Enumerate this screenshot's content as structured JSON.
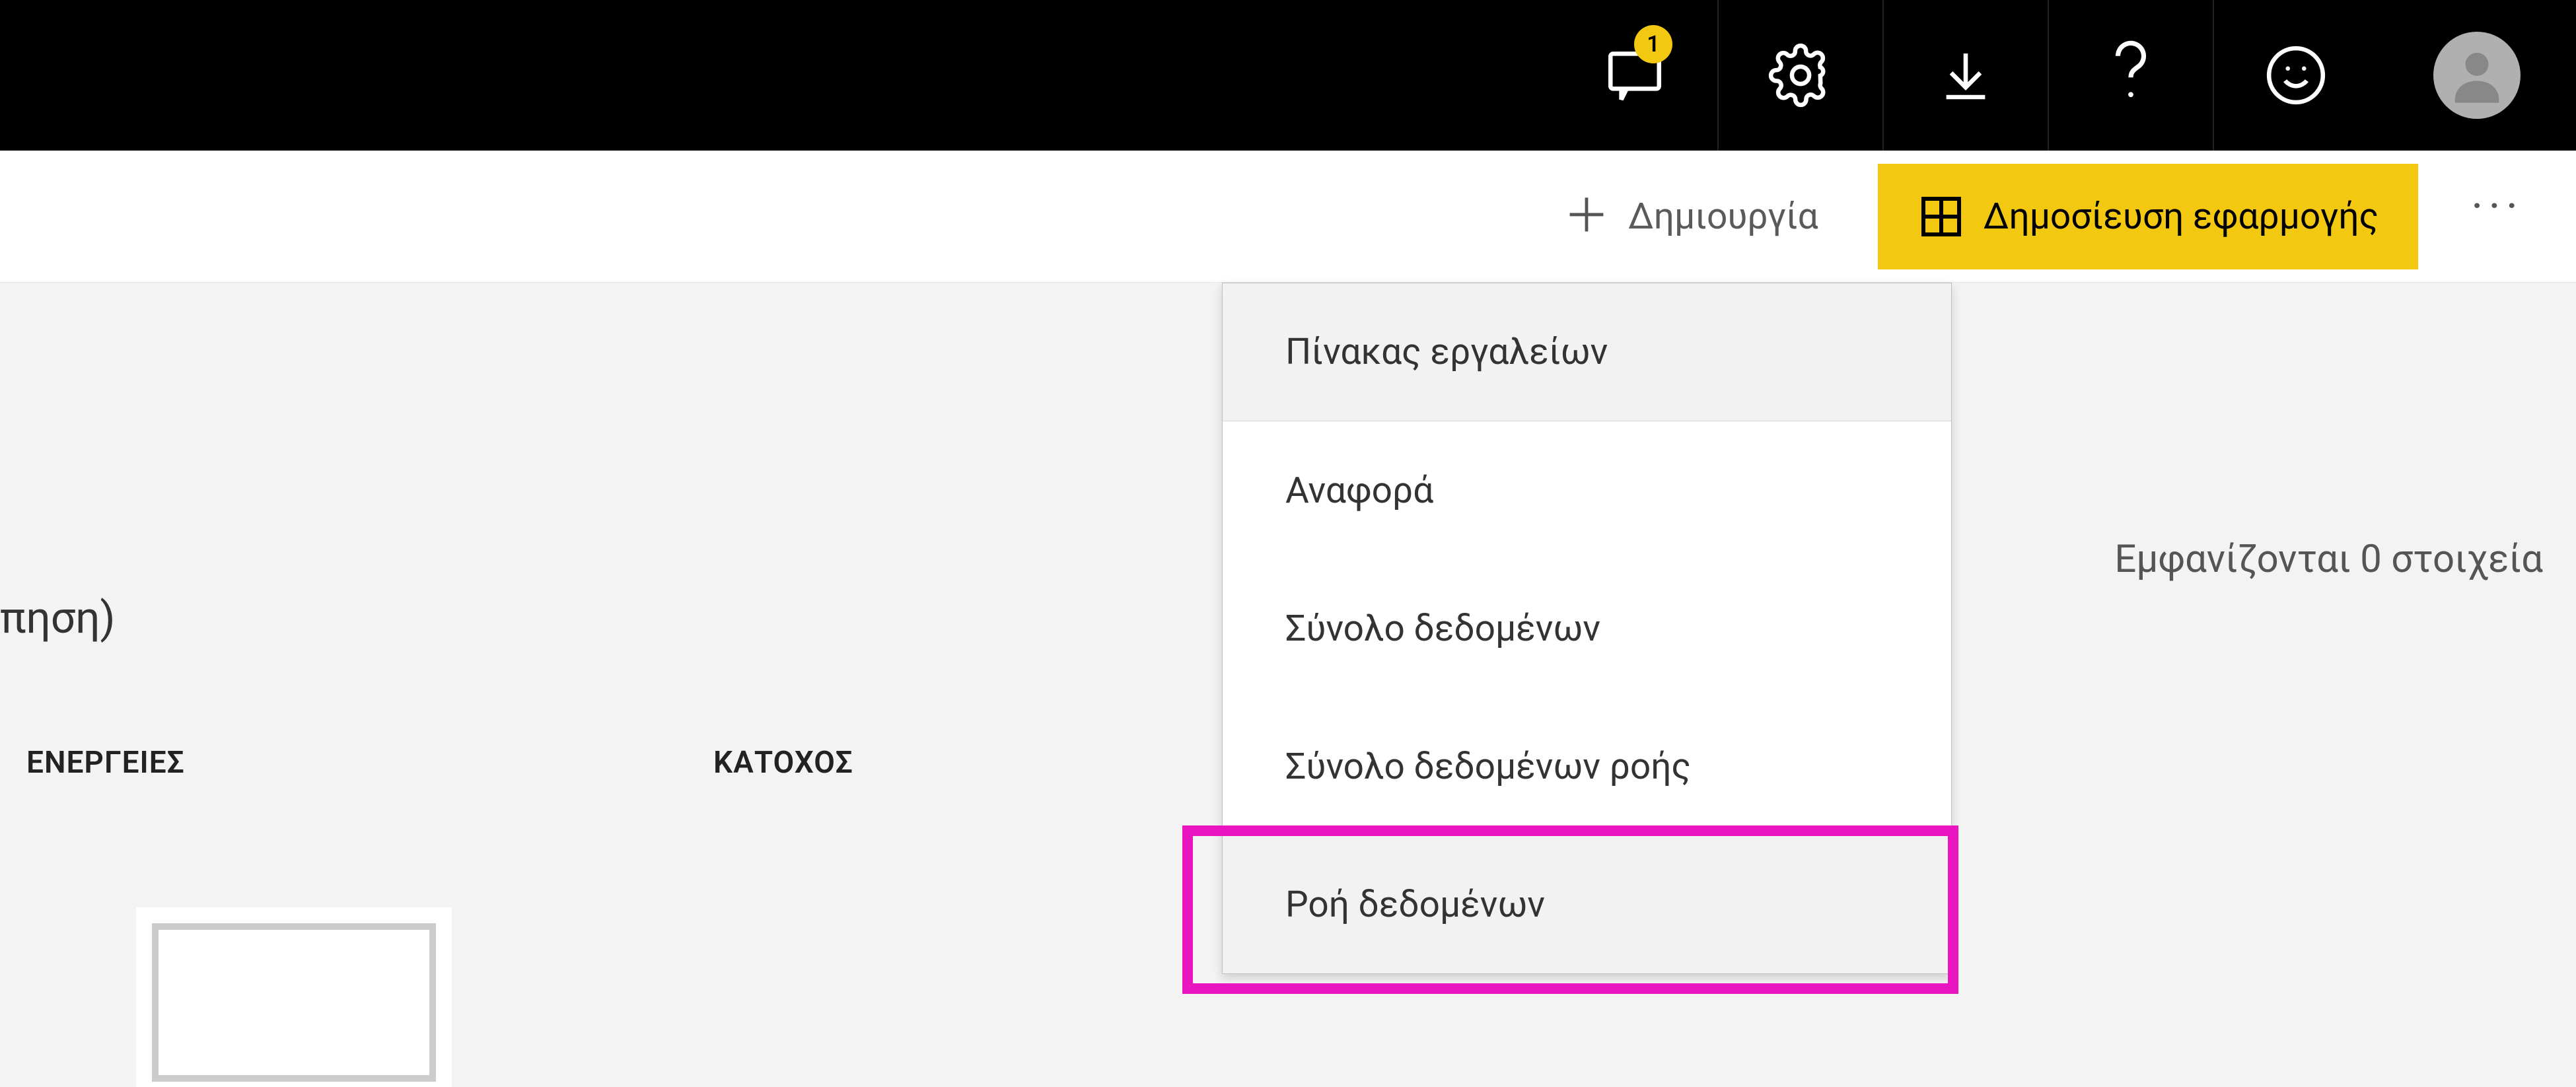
{
  "topbar": {
    "notification_count": "1"
  },
  "actionbar": {
    "create_label": "Δημιουργία",
    "publish_label": "Δημοσίευση εφαρμογής"
  },
  "content": {
    "truncated_left": "πηση)",
    "col_actions": "ΕΝΕΡΓΕΙΕΣ",
    "col_owner": "ΚΑΤΟΧΟΣ",
    "items_count": "Εμφανίζονται 0 στοιχεία"
  },
  "dropdown": {
    "items": [
      "Πίνακας εργαλείων",
      "Αναφορά",
      "Σύνολο δεδομένων",
      "Σύνολο δεδομένων ροής",
      "Ροή δεδομένων"
    ]
  }
}
